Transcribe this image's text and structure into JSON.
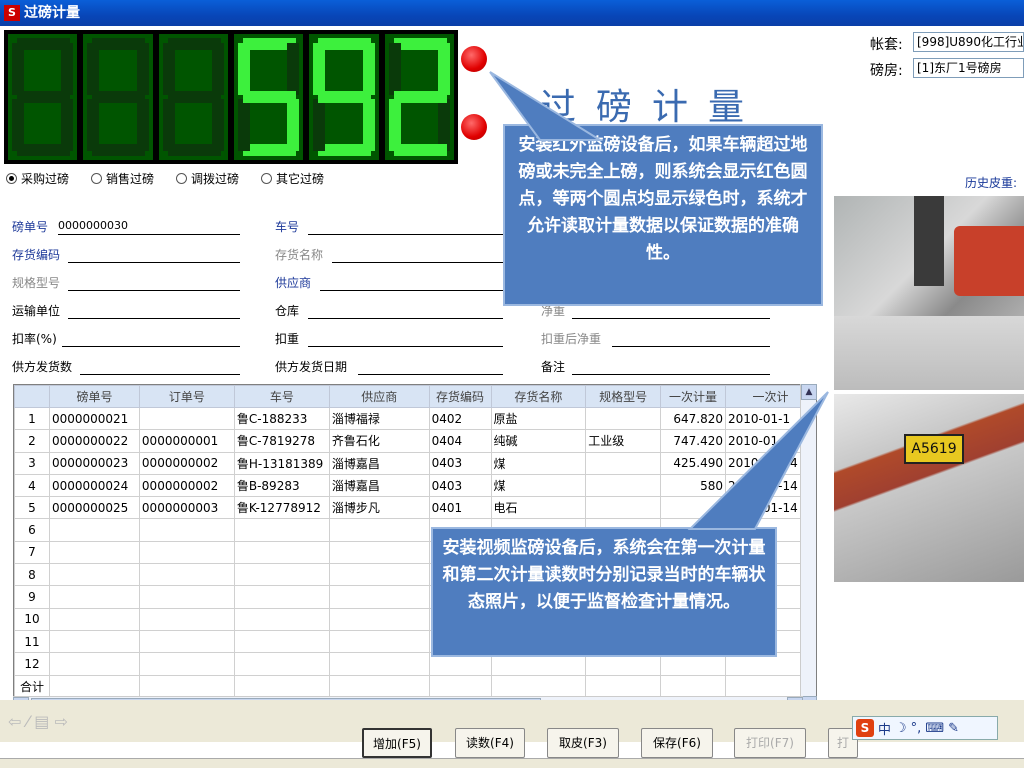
{
  "window": {
    "title": "过磅计量",
    "logo": "S"
  },
  "display": {
    "digits": [
      "8",
      "8",
      "8",
      "5",
      "9",
      "2"
    ],
    "lit": [
      false,
      false,
      false,
      true,
      true,
      true
    ]
  },
  "header": {
    "big_title": "过磅计量",
    "account_label": "帐套:",
    "account_value": "[998]U890化工行业",
    "room_label": "磅房:",
    "room_value": "[1]东厂1号磅房",
    "history_label": "历史皮重:"
  },
  "radios": [
    {
      "label": "采购过磅",
      "selected": true
    },
    {
      "label": "销售过磅",
      "selected": false
    },
    {
      "label": "调拨过磅",
      "selected": false
    },
    {
      "label": "其它过磅",
      "selected": false
    }
  ],
  "form": {
    "ticket_no_label": "磅单号",
    "ticket_no_value": "0000000030",
    "truck_no_label": "车号",
    "inv_code_label": "存货编码",
    "inv_name_label": "存货名称",
    "spec_label": "规格型号",
    "supplier_label": "供应商",
    "transport_label": "运输单位",
    "warehouse_label": "仓库",
    "net_label": "净重",
    "deduct_rate_label": "扣率(%)",
    "deduct_label": "扣重",
    "net_after_label": "扣重后净重",
    "sup_qty_label": "供方发货数",
    "sup_date_label": "供方发货日期",
    "remark_label": "备注"
  },
  "table": {
    "headers": [
      "",
      "磅单号",
      "订单号",
      "车号",
      "供应商",
      "存货编码",
      "存货名称",
      "规格型号",
      "一次计量",
      "一次计"
    ],
    "rows": [
      [
        "1",
        "0000000021",
        "",
        "鲁C-188233",
        "淄博福禄",
        "0402",
        "原盐",
        "",
        "647.820",
        "2010-01-1"
      ],
      [
        "2",
        "0000000022",
        "0000000001",
        "鲁C-7819278",
        "齐鲁石化",
        "0404",
        "纯碱",
        "工业级",
        "747.420",
        "2010-01-14"
      ],
      [
        "3",
        "0000000023",
        "0000000002",
        "鲁H-13181389",
        "淄博嘉昌",
        "0403",
        "煤",
        "",
        "425.490",
        "2010-01-14"
      ],
      [
        "4",
        "0000000024",
        "0000000002",
        "鲁B-89283",
        "淄博嘉昌",
        "0403",
        "煤",
        "",
        "580",
        "2010-01-14"
      ],
      [
        "5",
        "0000000025",
        "0000000003",
        "鲁K-12778912",
        "淄博步凡",
        "0401",
        "电石",
        "",
        "",
        "2010-01-14"
      ],
      [
        "6",
        "",
        "",
        "",
        "",
        "",
        "",
        "",
        "",
        ""
      ],
      [
        "7",
        "",
        "",
        "",
        "",
        "",
        "",
        "",
        "",
        ""
      ],
      [
        "8",
        "",
        "",
        "",
        "",
        "",
        "",
        "",
        "",
        ""
      ],
      [
        "9",
        "",
        "",
        "",
        "",
        "",
        "",
        "",
        "",
        ""
      ],
      [
        "10",
        "",
        "",
        "",
        "",
        "",
        "",
        "",
        "",
        ""
      ],
      [
        "11",
        "",
        "",
        "",
        "",
        "",
        "",
        "",
        "",
        ""
      ],
      [
        "12",
        "",
        "",
        "",
        "",
        "",
        "",
        "",
        "",
        ""
      ],
      [
        "合计",
        "",
        "",
        "",
        "",
        "",
        "",
        "",
        "",
        ""
      ]
    ]
  },
  "photo2": {
    "plate": "A5619"
  },
  "buttons": [
    {
      "label": "增加(F5)",
      "active": true
    },
    {
      "label": "读数(F4)",
      "active": false
    },
    {
      "label": "取皮(F3)",
      "active": false
    },
    {
      "label": "保存(F6)",
      "active": false
    },
    {
      "label": "打印(F7)",
      "disabled": true
    },
    {
      "label": "打",
      "disabled": true
    }
  ],
  "callouts": {
    "top": "安装红外监磅设备后，如果车辆超过地磅或未完全上磅，则系统会显示红色圆点，等两个圆点均显示绿色时，系统才允许读取计量数据以保证数据的准确性。",
    "bottom": "安装视频监磅设备后，系统会在第一次计量和第二次计量读数时分别记录当时的车辆状态照片，以便于监督检查计量情况。"
  },
  "ime": {
    "s": "S",
    "text": "中"
  },
  "colors": {
    "callout_bg": "#4f7dbf",
    "digit_on": "#3df03d",
    "red_dot": "#e00000",
    "title_blue": "#3a6ab0"
  }
}
